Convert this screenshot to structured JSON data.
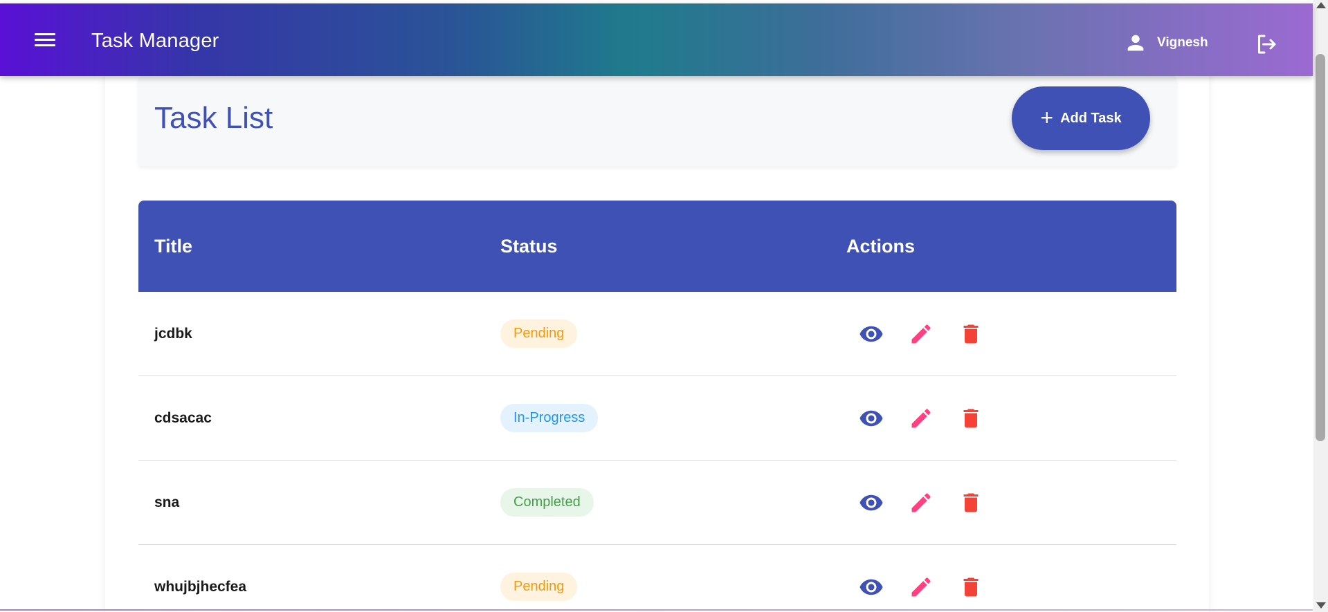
{
  "header": {
    "app_title": "Task Manager",
    "user_name": "Vignesh"
  },
  "page": {
    "title": "Task List",
    "add_button_label": "Add Task"
  },
  "table": {
    "columns": [
      "Title",
      "Status",
      "Actions"
    ],
    "rows": [
      {
        "title": "jcdbk",
        "status": "Pending"
      },
      {
        "title": "cdsacac",
        "status": "In-Progress"
      },
      {
        "title": "sna",
        "status": "Completed"
      },
      {
        "title": "whujbjhecfea",
        "status": "Pending"
      }
    ]
  },
  "colors": {
    "primary": "#3f51b5",
    "edit": "#ff4081",
    "delete": "#f44336",
    "pending": "#f59a0b",
    "in_progress": "#2196f3",
    "completed": "#43a047"
  },
  "icons": {
    "menu": "menu-icon",
    "user": "person-icon",
    "logout": "logout-icon",
    "add": "plus-icon",
    "view": "eye-icon",
    "edit": "pencil-icon",
    "delete": "trash-icon"
  }
}
